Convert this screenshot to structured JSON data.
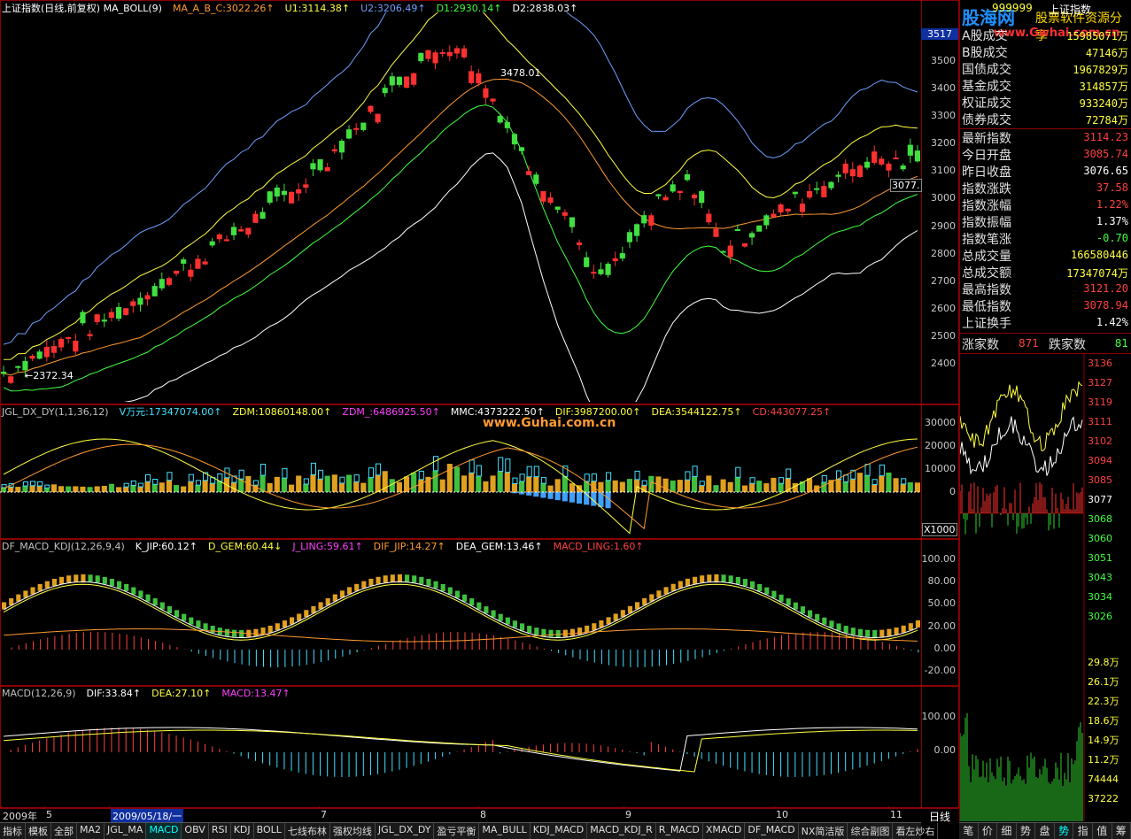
{
  "main": {
    "header": [
      {
        "text": "上证指数(日线,前复权) MA_BOLL(9)",
        "color": "#ffffff"
      },
      {
        "text": "MA_A_B_C:3022.26↑",
        "color": "#ff9a30"
      },
      {
        "text": "U1:3114.38↑",
        "color": "#ffff40"
      },
      {
        "text": "U2:3206.49↑",
        "color": "#6fa0ff"
      },
      {
        "text": "D1:2930.14↑",
        "color": "#40ff40"
      },
      {
        "text": "D2:2838.03↑",
        "color": "#ffffff"
      }
    ],
    "yticks": [
      "3500",
      "3400",
      "3300",
      "3200",
      "3100",
      "3000",
      "2900",
      "2800",
      "2700",
      "2600",
      "2500",
      "2400"
    ],
    "yrange": [
      2330,
      3560
    ],
    "high_label": "3478.01",
    "low_label": "2372.34",
    "last_label": "3077.",
    "top_value": "3517"
  },
  "dx": {
    "header": [
      {
        "text": "JGL_DX_DY(1,1,36,12)",
        "color": "#c0c0c0"
      },
      {
        "text": "V万元:17347074.00↑",
        "color": "#40e0ff"
      },
      {
        "text": "ZDM:10860148.00↑",
        "color": "#ffff40"
      },
      {
        "text": "ZDM_:6486925.50↑",
        "color": "#ff40ff"
      },
      {
        "text": "MMC:4373222.50↑",
        "color": "#ffffff"
      },
      {
        "text": "DIF:3987200.00↑",
        "color": "#ffff40"
      },
      {
        "text": "DEA:3544122.75↑",
        "color": "#ffff40"
      },
      {
        "text": "CD:443077.25↑",
        "color": "#ff4040"
      }
    ],
    "yticks": [
      "30000",
      "20000",
      "10000",
      "0"
    ],
    "unit": "X1000",
    "watermark": "www.Guhai.com.cn"
  },
  "kdj": {
    "header": [
      {
        "text": "DF_MACD_KDJ(12,26,9,4)",
        "color": "#c0c0c0"
      },
      {
        "text": "K_JIP:60.12↑",
        "color": "#ffffff"
      },
      {
        "text": "D_GEM:60.44↓",
        "color": "#ffff40"
      },
      {
        "text": "J_LING:59.61↑",
        "color": "#ff40ff"
      },
      {
        "text": "DIF_JIP:14.27↑",
        "color": "#ff9a30"
      },
      {
        "text": "DEA_GEM:13.46↑",
        "color": "#ffffff"
      },
      {
        "text": "MACD_LING:1.60↑",
        "color": "#ff4040"
      }
    ],
    "yticks": [
      "100.00",
      "80.00",
      "50.00",
      "20.00",
      "0.00",
      "-20.00"
    ]
  },
  "macd": {
    "header": [
      {
        "text": "MACD(12,26,9)",
        "color": "#c0c0c0"
      },
      {
        "text": "DIF:33.84↑",
        "color": "#ffffff"
      },
      {
        "text": "DEA:27.10↑",
        "color": "#ffff40"
      },
      {
        "text": "MACD:13.47↑",
        "color": "#ff40ff"
      }
    ],
    "yticks": [
      "100.00",
      "0.00"
    ]
  },
  "xaxis": {
    "labels": [
      {
        "text": "2009年",
        "x": 3
      },
      {
        "text": "5",
        "x": 52
      },
      {
        "text": "2009/05/18/一",
        "x": 125,
        "hl": true
      },
      {
        "text": "7",
        "x": 362
      },
      {
        "text": "8",
        "x": 542
      },
      {
        "text": "9",
        "x": 706
      },
      {
        "text": "10",
        "x": 876
      },
      {
        "text": "11",
        "x": 1005
      }
    ],
    "period": "日线"
  },
  "tabs": [
    "指标",
    "模板",
    "全部",
    "MA2",
    "JGL_MA",
    "MACD",
    "OBV",
    "RSI",
    "KDJ",
    "BOLL",
    "七线布林",
    "强权均线",
    "JGL_DX_DY",
    "盈亏平衡",
    "MA_BULL",
    "KDJ_MACD",
    "MACD_KDJ_R",
    "R_MACD",
    "XMACD",
    "DF_MACD",
    "NX简洁版",
    "综合副图",
    "看左炒右"
  ],
  "active_tab": "MACD",
  "right_tabs": [
    "笔",
    "价",
    "细",
    "势",
    "盘",
    "势",
    "指",
    "值",
    "筹"
  ],
  "right_active": "势",
  "side": {
    "logo": "股海网",
    "logo_sub": "股票软件资源分享",
    "logo_url": "www.Gwhai.com.cn",
    "code": "999999",
    "name": "上证指数",
    "rows_a": [
      {
        "k": "A股成交",
        "v": "15985071万",
        "c": "yel"
      },
      {
        "k": "B股成交",
        "v": "47146万",
        "c": "yel"
      },
      {
        "k": "国债成交",
        "v": "1967829万",
        "c": "yel"
      },
      {
        "k": "基金成交",
        "v": "314857万",
        "c": "yel"
      },
      {
        "k": "权证成交",
        "v": "933240万",
        "c": "yel"
      },
      {
        "k": "债券成交",
        "v": "72784万",
        "c": "yel"
      }
    ],
    "rows_b": [
      {
        "k": "最新指数",
        "v": "3114.23",
        "c": "red"
      },
      {
        "k": "今日开盘",
        "v": "3085.74",
        "c": "red"
      },
      {
        "k": "昨日收盘",
        "v": "3076.65",
        "c": "wht"
      },
      {
        "k": "指数涨跌",
        "v": "37.58",
        "c": "red"
      },
      {
        "k": "指数涨幅",
        "v": "1.22%",
        "c": "red"
      },
      {
        "k": "指数振幅",
        "v": "1.37%",
        "c": "wht"
      },
      {
        "k": "指数笔涨",
        "v": "-0.70",
        "c": "grn"
      },
      {
        "k": "总成交量",
        "v": "166580446",
        "c": "yel"
      },
      {
        "k": "总成交额",
        "v": "17347074万",
        "c": "yel"
      },
      {
        "k": "最高指数",
        "v": "3121.20",
        "c": "red"
      },
      {
        "k": "最低指数",
        "v": "3078.94",
        "c": "red"
      },
      {
        "k": "上证换手",
        "v": "1.42%",
        "c": "wht"
      }
    ],
    "up_label": "涨家数",
    "up": "871",
    "down_label": "跌家数",
    "down": "81",
    "mini_ticks": [
      "3136",
      "3127",
      "3119",
      "3111",
      "3102",
      "3094",
      "3085",
      "3077",
      "3068",
      "3060",
      "3051",
      "3043",
      "3034",
      "3026"
    ],
    "vol_ticks": [
      "29.8万",
      "26.1万",
      "22.3万",
      "18.6万",
      "14.9万",
      "11.2万",
      "74444",
      "37222"
    ]
  }
}
